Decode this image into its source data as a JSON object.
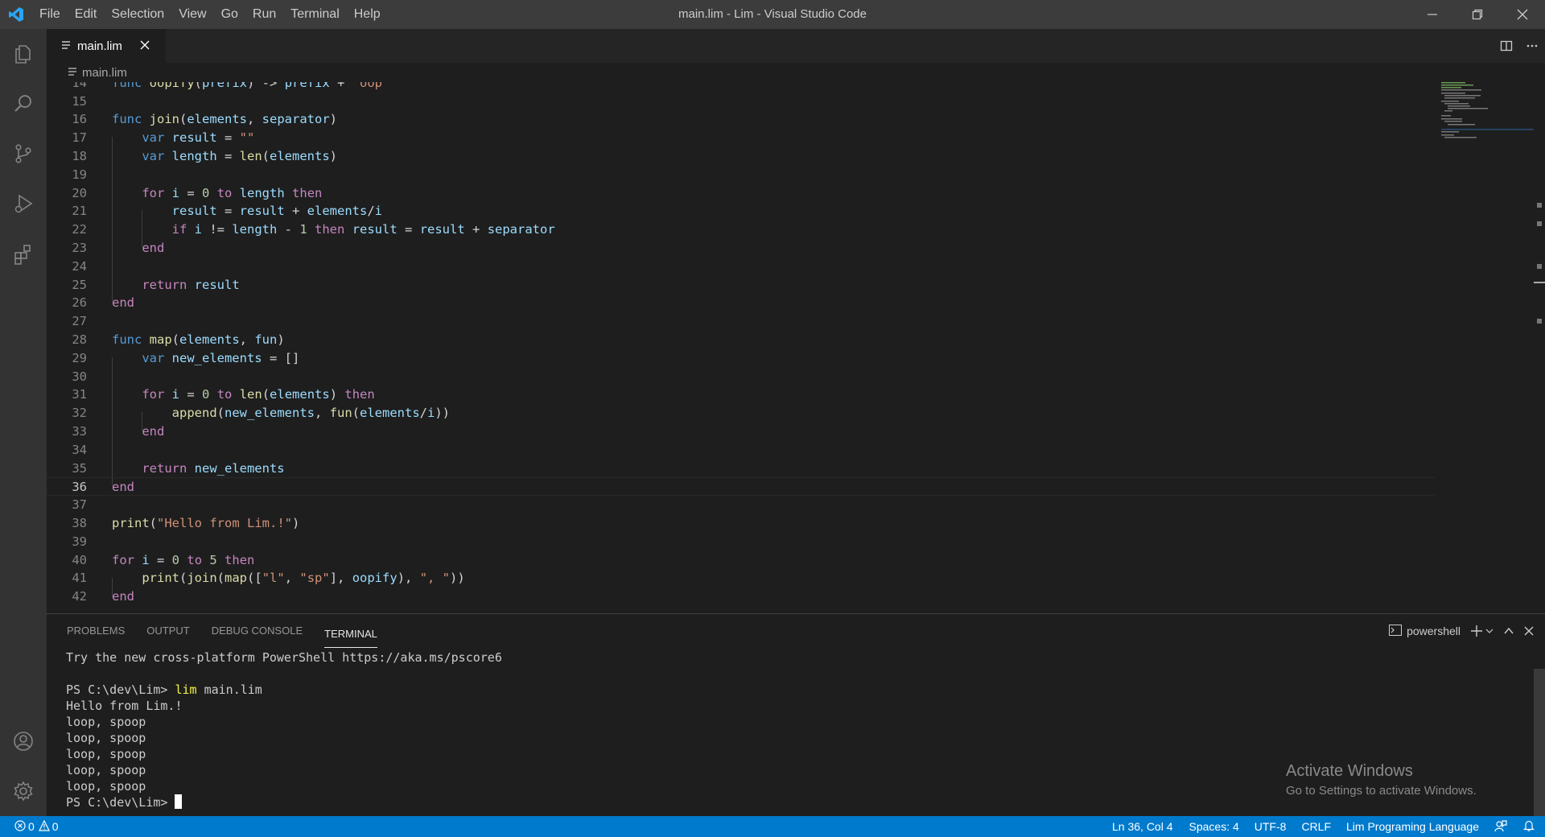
{
  "window": {
    "title": "main.lim - Lim - Visual Studio Code"
  },
  "menu": [
    "File",
    "Edit",
    "Selection",
    "View",
    "Go",
    "Run",
    "Terminal",
    "Help"
  ],
  "tab": {
    "label": "main.lim"
  },
  "breadcrumb": {
    "file": "main.lim"
  },
  "editor": {
    "lines": [
      {
        "n": "14",
        "tokens": [
          [
            "func ",
            "dk"
          ],
          [
            "oopify",
            "fn"
          ],
          [
            "(",
            "dflt"
          ],
          [
            "prefix",
            "vr"
          ],
          [
            ") -> ",
            "dflt"
          ],
          [
            "prefix",
            "vr"
          ],
          [
            " + ",
            "dflt"
          ],
          [
            "\"oop\"",
            "st"
          ]
        ]
      },
      {
        "n": "15",
        "tokens": []
      },
      {
        "n": "16",
        "tokens": [
          [
            "func ",
            "dk"
          ],
          [
            "join",
            "fn"
          ],
          [
            "(",
            "dflt"
          ],
          [
            "elements",
            "vr"
          ],
          [
            ", ",
            "dflt"
          ],
          [
            "separator",
            "vr"
          ],
          [
            ")",
            "dflt"
          ]
        ]
      },
      {
        "n": "17",
        "tokens": [
          [
            "    ",
            "dflt"
          ],
          [
            "var ",
            "dk"
          ],
          [
            "result",
            "vr"
          ],
          [
            " = ",
            "dflt"
          ],
          [
            "\"\"",
            "st"
          ]
        ]
      },
      {
        "n": "18",
        "tokens": [
          [
            "    ",
            "dflt"
          ],
          [
            "var ",
            "dk"
          ],
          [
            "length",
            "vr"
          ],
          [
            " = ",
            "dflt"
          ],
          [
            "len",
            "fn"
          ],
          [
            "(",
            "dflt"
          ],
          [
            "elements",
            "vr"
          ],
          [
            ")",
            "dflt"
          ]
        ]
      },
      {
        "n": "19",
        "tokens": []
      },
      {
        "n": "20",
        "tokens": [
          [
            "    ",
            "dflt"
          ],
          [
            "for ",
            "kw"
          ],
          [
            "i",
            "vr"
          ],
          [
            " = ",
            "dflt"
          ],
          [
            "0",
            "nm"
          ],
          [
            " ",
            "dflt"
          ],
          [
            "to ",
            "kw"
          ],
          [
            "length",
            "vr"
          ],
          [
            " ",
            "dflt"
          ],
          [
            "then",
            "kw"
          ]
        ]
      },
      {
        "n": "21",
        "tokens": [
          [
            "        ",
            "dflt"
          ],
          [
            "result",
            "vr"
          ],
          [
            " = ",
            "dflt"
          ],
          [
            "result",
            "vr"
          ],
          [
            " + ",
            "dflt"
          ],
          [
            "elements",
            "vr"
          ],
          [
            "/",
            "dflt"
          ],
          [
            "i",
            "vr"
          ]
        ]
      },
      {
        "n": "22",
        "tokens": [
          [
            "        ",
            "dflt"
          ],
          [
            "if ",
            "kw"
          ],
          [
            "i",
            "vr"
          ],
          [
            " != ",
            "dflt"
          ],
          [
            "length",
            "vr"
          ],
          [
            " - ",
            "dflt"
          ],
          [
            "1",
            "nm"
          ],
          [
            " ",
            "dflt"
          ],
          [
            "then ",
            "kw"
          ],
          [
            "result",
            "vr"
          ],
          [
            " = ",
            "dflt"
          ],
          [
            "result",
            "vr"
          ],
          [
            " + ",
            "dflt"
          ],
          [
            "separator",
            "vr"
          ]
        ]
      },
      {
        "n": "23",
        "tokens": [
          [
            "    ",
            "dflt"
          ],
          [
            "end",
            "kw"
          ]
        ]
      },
      {
        "n": "24",
        "tokens": []
      },
      {
        "n": "25",
        "tokens": [
          [
            "    ",
            "dflt"
          ],
          [
            "return ",
            "kw"
          ],
          [
            "result",
            "vr"
          ]
        ]
      },
      {
        "n": "26",
        "tokens": [
          [
            "end",
            "kw"
          ]
        ]
      },
      {
        "n": "27",
        "tokens": []
      },
      {
        "n": "28",
        "tokens": [
          [
            "func ",
            "dk"
          ],
          [
            "map",
            "fn"
          ],
          [
            "(",
            "dflt"
          ],
          [
            "elements",
            "vr"
          ],
          [
            ", ",
            "dflt"
          ],
          [
            "fun",
            "vr"
          ],
          [
            ")",
            "dflt"
          ]
        ]
      },
      {
        "n": "29",
        "tokens": [
          [
            "    ",
            "dflt"
          ],
          [
            "var ",
            "dk"
          ],
          [
            "new_elements",
            "vr"
          ],
          [
            " = []",
            "dflt"
          ]
        ]
      },
      {
        "n": "30",
        "tokens": []
      },
      {
        "n": "31",
        "tokens": [
          [
            "    ",
            "dflt"
          ],
          [
            "for ",
            "kw"
          ],
          [
            "i",
            "vr"
          ],
          [
            " = ",
            "dflt"
          ],
          [
            "0",
            "nm"
          ],
          [
            " ",
            "dflt"
          ],
          [
            "to ",
            "kw"
          ],
          [
            "len",
            "fn"
          ],
          [
            "(",
            "dflt"
          ],
          [
            "elements",
            "vr"
          ],
          [
            ") ",
            "dflt"
          ],
          [
            "then",
            "kw"
          ]
        ]
      },
      {
        "n": "32",
        "tokens": [
          [
            "        ",
            "dflt"
          ],
          [
            "append",
            "fn"
          ],
          [
            "(",
            "dflt"
          ],
          [
            "new_elements",
            "vr"
          ],
          [
            ", ",
            "dflt"
          ],
          [
            "fun",
            "fn"
          ],
          [
            "(",
            "dflt"
          ],
          [
            "elements",
            "vr"
          ],
          [
            "/",
            "dflt"
          ],
          [
            "i",
            "vr"
          ],
          [
            "))",
            "dflt"
          ]
        ]
      },
      {
        "n": "33",
        "tokens": [
          [
            "    ",
            "dflt"
          ],
          [
            "end",
            "kw"
          ]
        ]
      },
      {
        "n": "34",
        "tokens": []
      },
      {
        "n": "35",
        "tokens": [
          [
            "    ",
            "dflt"
          ],
          [
            "return ",
            "kw"
          ],
          [
            "new_elements",
            "vr"
          ]
        ]
      },
      {
        "n": "36",
        "tokens": [
          [
            "end",
            "kw"
          ]
        ],
        "current": true
      },
      {
        "n": "37",
        "tokens": []
      },
      {
        "n": "38",
        "tokens": [
          [
            "print",
            "fn"
          ],
          [
            "(",
            "dflt"
          ],
          [
            "\"Hello from Lim.!\"",
            "st"
          ],
          [
            ")",
            "dflt"
          ]
        ]
      },
      {
        "n": "39",
        "tokens": []
      },
      {
        "n": "40",
        "tokens": [
          [
            "for ",
            "kw"
          ],
          [
            "i",
            "vr"
          ],
          [
            " = ",
            "dflt"
          ],
          [
            "0",
            "nm"
          ],
          [
            " ",
            "dflt"
          ],
          [
            "to ",
            "kw"
          ],
          [
            "5",
            "nm"
          ],
          [
            " ",
            "dflt"
          ],
          [
            "then",
            "kw"
          ]
        ]
      },
      {
        "n": "41",
        "tokens": [
          [
            "    ",
            "dflt"
          ],
          [
            "print",
            "fn"
          ],
          [
            "(",
            "dflt"
          ],
          [
            "join",
            "fn"
          ],
          [
            "(",
            "dflt"
          ],
          [
            "map",
            "fn"
          ],
          [
            "([",
            "dflt"
          ],
          [
            "\"l\"",
            "st"
          ],
          [
            ", ",
            "dflt"
          ],
          [
            "\"sp\"",
            "st"
          ],
          [
            "], ",
            "dflt"
          ],
          [
            "oopify",
            "vr"
          ],
          [
            "), ",
            "dflt"
          ],
          [
            "\", \"",
            "st"
          ],
          [
            "))",
            "dflt"
          ]
        ]
      },
      {
        "n": "42",
        "tokens": [
          [
            "end",
            "kw"
          ]
        ]
      }
    ]
  },
  "panel": {
    "tabs": [
      "PROBLEMS",
      "OUTPUT",
      "DEBUG CONSOLE",
      "TERMINAL"
    ],
    "active_tab": "TERMINAL",
    "shell": "powershell",
    "terminal": {
      "intro": "Try the new cross-platform PowerShell https://aka.ms/pscore6",
      "prompt1": "PS C:\\dev\\Lim> ",
      "command": "lim",
      "args": " main.lim",
      "output": [
        "Hello from Lim.!",
        "loop, spoop",
        "loop, spoop",
        "loop, spoop",
        "loop, spoop",
        "loop, spoop"
      ],
      "prompt2": "PS C:\\dev\\Lim> "
    }
  },
  "watermark": {
    "line1": "Activate Windows",
    "line2": "Go to Settings to activate Windows."
  },
  "status": {
    "errors": "0",
    "warnings": "0",
    "position": "Ln 36, Col 4",
    "spaces": "Spaces: 4",
    "encoding": "UTF-8",
    "eol": "CRLF",
    "language": "Lim Programing Language"
  },
  "colors": {
    "statusbar": "#007acc",
    "accent": "#0098ff"
  }
}
